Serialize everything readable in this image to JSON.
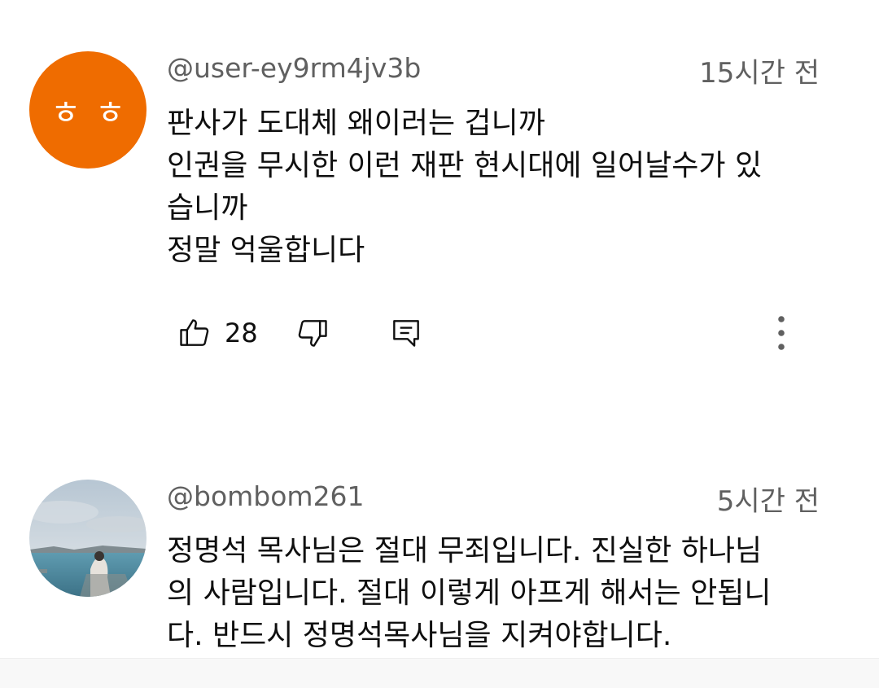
{
  "comments": [
    {
      "avatar_text": "ㅎㅎ",
      "avatar_color": "#ef6c00",
      "handle": "@user-ey9rm4jv3b",
      "time": "15시간 전",
      "lines": [
        "판사가 도대체 왜이러는 겁니까",
        "인권을 무시한 이런 재판 현시대에 일어날수가 있",
        "습니까",
        "정말 억울합니다"
      ],
      "like_count": "28",
      "icons": {
        "like": "thumbs-up-icon",
        "dislike": "thumbs-down-icon",
        "reply": "reply-comment-icon",
        "more": "more-vertical-icon"
      }
    },
    {
      "avatar_type": "photo",
      "handle": "@bombom261",
      "time": "5시간 전",
      "lines": [
        "정명석 목사님은 절대 무죄입니다. 진실한 하나님",
        "의 사람입니다. 절대 이렇게 아프게 해서는 안됩니",
        "다. 반드시 정명석목사님을 지켜야합니다."
      ]
    }
  ],
  "colors": {
    "secondary_text": "#606060",
    "primary_text": "#0f0f0f"
  }
}
